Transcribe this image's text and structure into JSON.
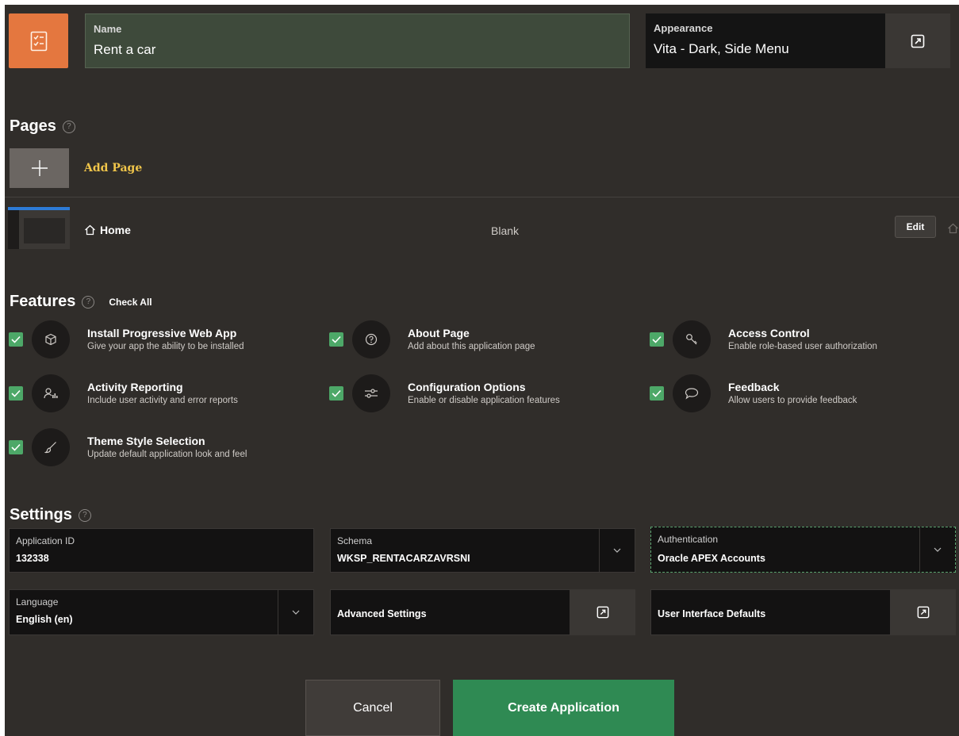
{
  "app": {
    "name_label": "Name",
    "name_value": "Rent a car",
    "appearance_label": "Appearance",
    "appearance_value": "Vita - Dark, Side Menu"
  },
  "pages": {
    "title": "Pages",
    "add_label": "Add Page",
    "items": [
      {
        "name": "Home",
        "type": "Blank",
        "edit_label": "Edit"
      }
    ]
  },
  "features": {
    "title": "Features",
    "check_all": "Check All",
    "items": [
      {
        "title": "Install Progressive Web App",
        "desc": "Give your app the ability to be installed",
        "icon": "package-icon",
        "checked": true
      },
      {
        "title": "About Page",
        "desc": "Add about this application page",
        "icon": "question-icon",
        "checked": true
      },
      {
        "title": "Access Control",
        "desc": "Enable role-based user authorization",
        "icon": "key-icon",
        "checked": true
      },
      {
        "title": "Activity Reporting",
        "desc": "Include user activity and error reports",
        "icon": "user-chart-icon",
        "checked": true
      },
      {
        "title": "Configuration Options",
        "desc": "Enable or disable application features",
        "icon": "sliders-icon",
        "checked": true
      },
      {
        "title": "Feedback",
        "desc": "Allow users to provide feedback",
        "icon": "speech-bubble-icon",
        "checked": true
      },
      {
        "title": "Theme Style Selection",
        "desc": "Update default application look and feel",
        "icon": "brush-icon",
        "checked": true
      }
    ]
  },
  "settings": {
    "title": "Settings",
    "application_id": {
      "label": "Application ID",
      "value": "132338"
    },
    "schema": {
      "label": "Schema",
      "value": "WKSP_RENTACARZAVRSNI"
    },
    "authentication": {
      "label": "Authentication",
      "value": "Oracle APEX Accounts"
    },
    "language": {
      "label": "Language",
      "value": "English (en)"
    },
    "advanced_settings": "Advanced Settings",
    "ui_defaults": "User Interface Defaults"
  },
  "buttons": {
    "cancel": "Cancel",
    "create": "Create Application"
  },
  "colors": {
    "background": "#302d2a",
    "accent_orange": "#e4773f",
    "create_green": "#2f8a53",
    "check_green": "#4da868",
    "add_page_yellow": "#f0c54a"
  }
}
